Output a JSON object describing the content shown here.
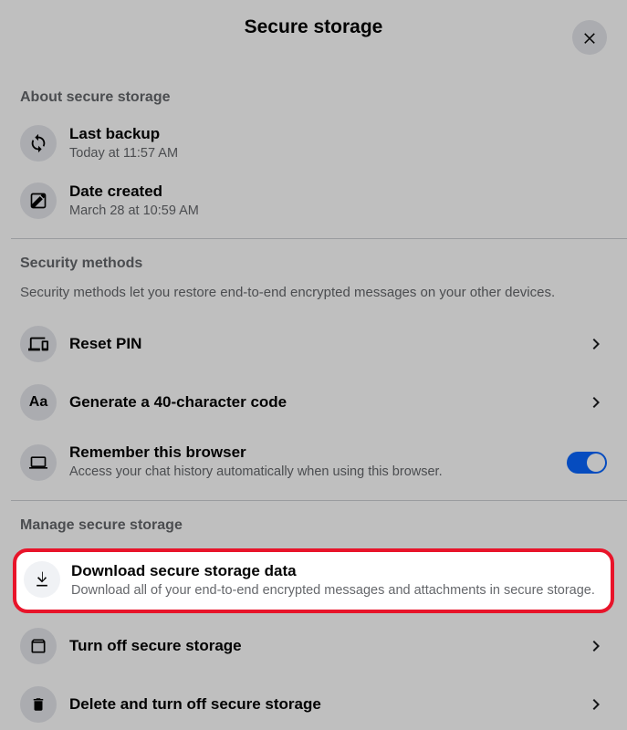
{
  "header": {
    "title": "Secure storage"
  },
  "about": {
    "heading": "About secure storage",
    "lastBackup": {
      "title": "Last backup",
      "sub": "Today at 11:57 AM"
    },
    "dateCreated": {
      "title": "Date created",
      "sub": "March 28 at 10:59 AM"
    }
  },
  "security": {
    "heading": "Security methods",
    "desc": "Security methods let you restore end-to-end encrypted messages on your other devices.",
    "resetPin": {
      "title": "Reset PIN"
    },
    "generateCode": {
      "title": "Generate a 40-character code"
    },
    "remember": {
      "title": "Remember this browser",
      "sub": "Access your chat history automatically when using this browser."
    }
  },
  "manage": {
    "heading": "Manage secure storage",
    "download": {
      "title": "Download secure storage data",
      "sub": "Download all of your end-to-end encrypted messages and attachments in secure storage."
    },
    "turnOff": {
      "title": "Turn off secure storage"
    },
    "delete": {
      "title": "Delete and turn off secure storage"
    }
  }
}
